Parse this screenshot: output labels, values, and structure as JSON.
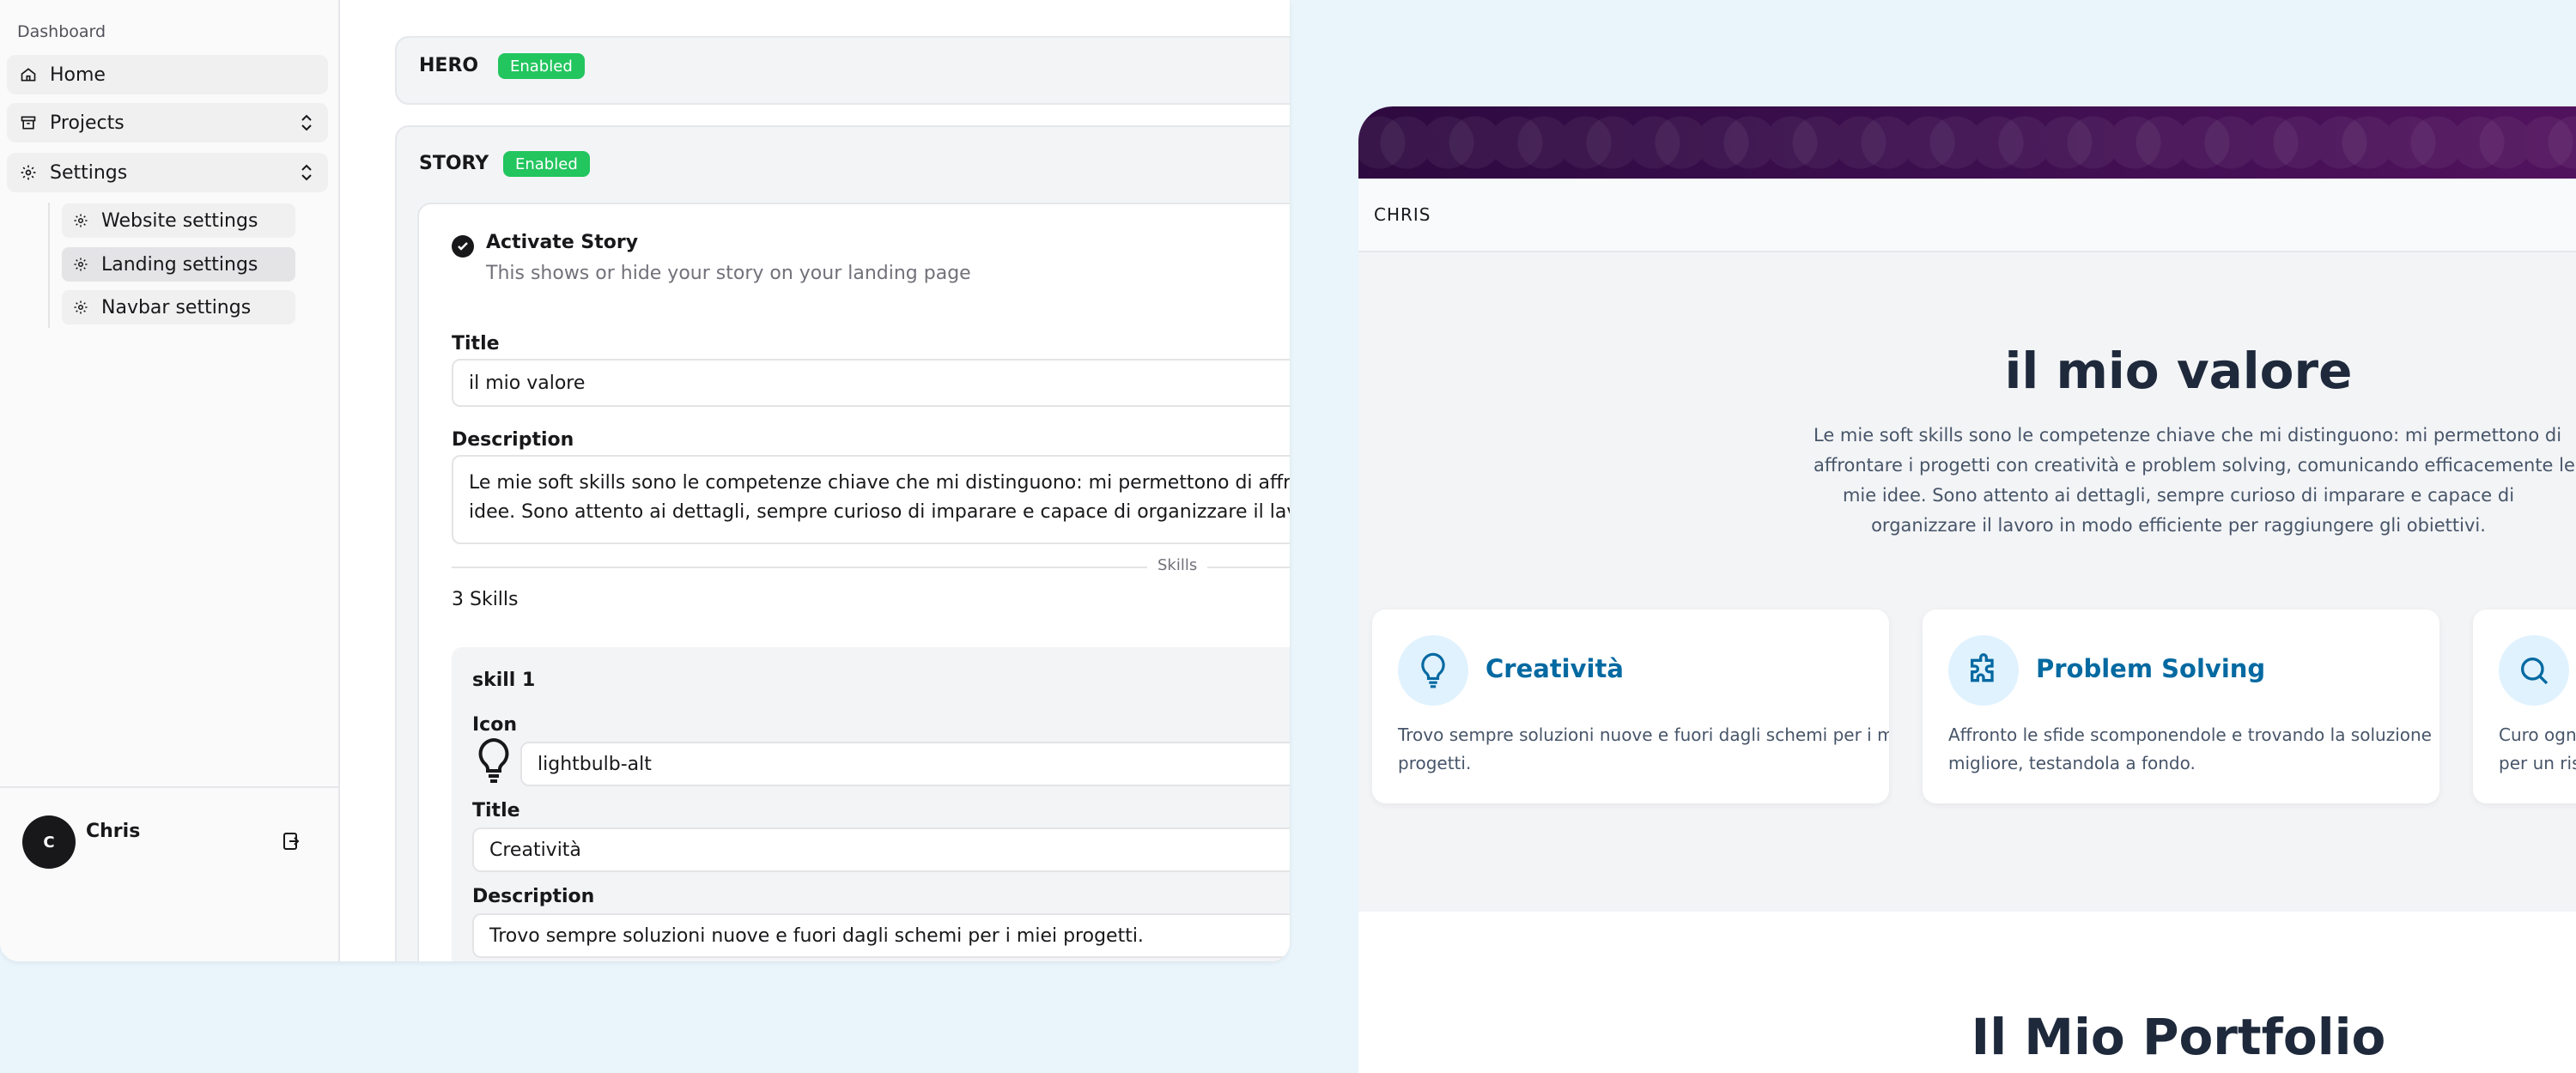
{
  "sidebar": {
    "group_label": "Dashboard",
    "items": [
      {
        "label": "Home",
        "icon": "home-icon"
      },
      {
        "label": "Projects",
        "icon": "archive-icon"
      },
      {
        "label": "Settings",
        "icon": "gear-icon"
      }
    ],
    "sub_items": [
      {
        "label": "Website settings",
        "icon": "gear-icon"
      },
      {
        "label": "Landing settings",
        "icon": "gear-icon",
        "active": true
      },
      {
        "label": "Navbar settings",
        "icon": "gear-icon"
      }
    ],
    "user": {
      "initial": "C",
      "name": "Chris"
    }
  },
  "editor": {
    "hero": {
      "title": "HERO",
      "badge": "Enabled"
    },
    "story": {
      "title": "STORY",
      "badge": "Enabled",
      "activate_label": "Activate Story",
      "activate_help": "This shows or hide your story on your landing page",
      "title_label": "Title",
      "title_value": "il mio valore",
      "description_label": "Description",
      "description_line1": "Le mie soft skills sono le competenze chiave che mi distinguono: mi permettono di affrontare i pro",
      "description_line2": "idee. Sono attento ai dettagli, sempre curioso di imparare e capace di organizzare il lavoro in mod",
      "skills_separator": "Skills",
      "skills_count": "3 Skills",
      "skill": {
        "heading": "skill 1",
        "icon_label": "Icon",
        "icon_value": "lightbulb-alt",
        "title_label": "Title",
        "title_value": "Creatività",
        "description_label": "Description",
        "description_value": "Trovo sempre soluzioni nuove e fuori dagli schemi per i miei progetti."
      }
    }
  },
  "preview": {
    "brand": "CHRIS",
    "story_title": "il mio valore",
    "story_desc_lines": [
      "Le mie soft skills sono le competenze chiave che mi distinguono: mi permettono di",
      "affrontare i progetti con creatività e problem solving, comunicando efficacemente le",
      "mie idee. Sono attento ai dettagli, sempre curioso di imparare e capace di",
      "organizzare il lavoro in modo efficiente per raggiungere gli obiettivi."
    ],
    "skills": [
      {
        "name": "Creatività",
        "icon": "lightbulb-icon",
        "desc_lines": [
          "Trovo sempre soluzioni nuove e fuori dagli schemi per i miei",
          "progetti."
        ]
      },
      {
        "name": "Problem Solving",
        "icon": "puzzle-icon",
        "desc_lines": [
          "Affronto le sfide scomponendole e trovando la soluzione",
          "migliore, testandola a fondo."
        ]
      },
      {
        "name": "",
        "icon": "search-icon",
        "desc_lines": [
          "Curo ogni",
          "per un risu"
        ]
      }
    ],
    "portfolio_title": "Il Mio Portfolio"
  },
  "colors": {
    "accent_green": "#22c55e",
    "accent_blue": "#0369a1",
    "banner_purple": "#3d0f4f",
    "page_bg": "#e9f4fb"
  }
}
